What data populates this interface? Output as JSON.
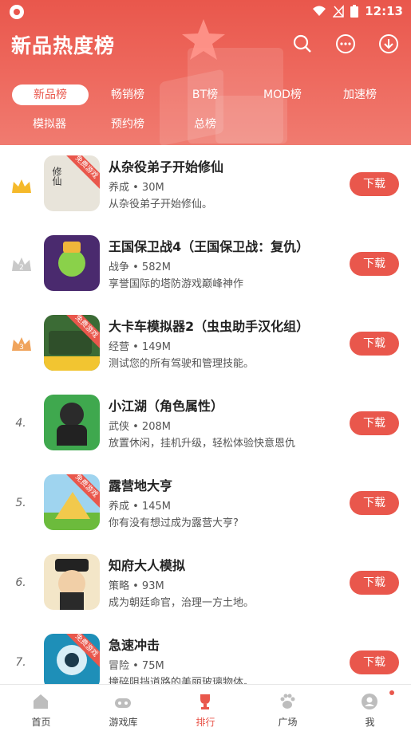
{
  "status": {
    "time": "12:13"
  },
  "header": {
    "title": "新品热度榜"
  },
  "tabs": [
    {
      "label": "新品榜"
    },
    {
      "label": "畅销榜"
    },
    {
      "label": "BT榜"
    },
    {
      "label": "MOD榜"
    },
    {
      "label": "加速榜"
    },
    {
      "label": "模拟器"
    },
    {
      "label": "预约榜"
    },
    {
      "label": "总榜"
    }
  ],
  "apps": [
    {
      "rank": "",
      "badge": "crown-gold",
      "name": "从杂役弟子开始修仙",
      "meta": "养成 • 30M",
      "desc": "从杂役弟子开始修仙。",
      "ribbon": "免费游戏",
      "button": "下载",
      "thumb_color": "#e8e4da"
    },
    {
      "rank": "2",
      "badge": "crown-silver",
      "name": "王国保卫战4（王国保卫战：复仇）",
      "meta": "战争 • 582M",
      "desc": "享誉国际的塔防游戏巅峰神作",
      "ribbon": "",
      "button": "下载",
      "thumb_color": "#4a2a6e"
    },
    {
      "rank": "3",
      "badge": "crown-bronze",
      "name": "大卡车模拟器2（虫虫助手汉化组）",
      "meta": "经营 • 149M",
      "desc": "测试您的所有驾驶和管理技能。",
      "ribbon": "免费游戏",
      "button": "下载",
      "thumb_color": "#3b6b35"
    },
    {
      "rank": "4.",
      "badge": "",
      "name": "小江湖（角色属性）",
      "meta": "武侠 • 208M",
      "desc": "放置休闲，挂机升级，轻松体验快意恩仇",
      "ribbon": "",
      "button": "下载",
      "thumb_color": "#3fa84e"
    },
    {
      "rank": "5.",
      "badge": "",
      "name": "露营地大亨",
      "meta": "养成 • 145M",
      "desc": "你有没有想过成为露营大亨?",
      "ribbon": "免费游戏",
      "button": "下载",
      "thumb_color": "#f2c94c"
    },
    {
      "rank": "6.",
      "badge": "",
      "name": "知府大人模拟",
      "meta": "策略 • 93M",
      "desc": "成为朝廷命官，治理一方土地。",
      "ribbon": "",
      "button": "下载",
      "thumb_color": "#f3e6c8"
    },
    {
      "rank": "7.",
      "badge": "",
      "name": "急速冲击",
      "meta": "冒险 • 75M",
      "desc": "撞碎阻挡道路的美丽玻璃物体。",
      "ribbon": "免费游戏",
      "button": "下载",
      "thumb_color": "#1e8fb8"
    }
  ],
  "nav": [
    {
      "label": "首页",
      "icon": "home-icon"
    },
    {
      "label": "游戏库",
      "icon": "gamepad-icon"
    },
    {
      "label": "排行",
      "icon": "trophy-icon"
    },
    {
      "label": "广场",
      "icon": "paw-icon"
    },
    {
      "label": "我",
      "icon": "user-icon"
    }
  ],
  "colors": {
    "accent": "#e9574c"
  }
}
